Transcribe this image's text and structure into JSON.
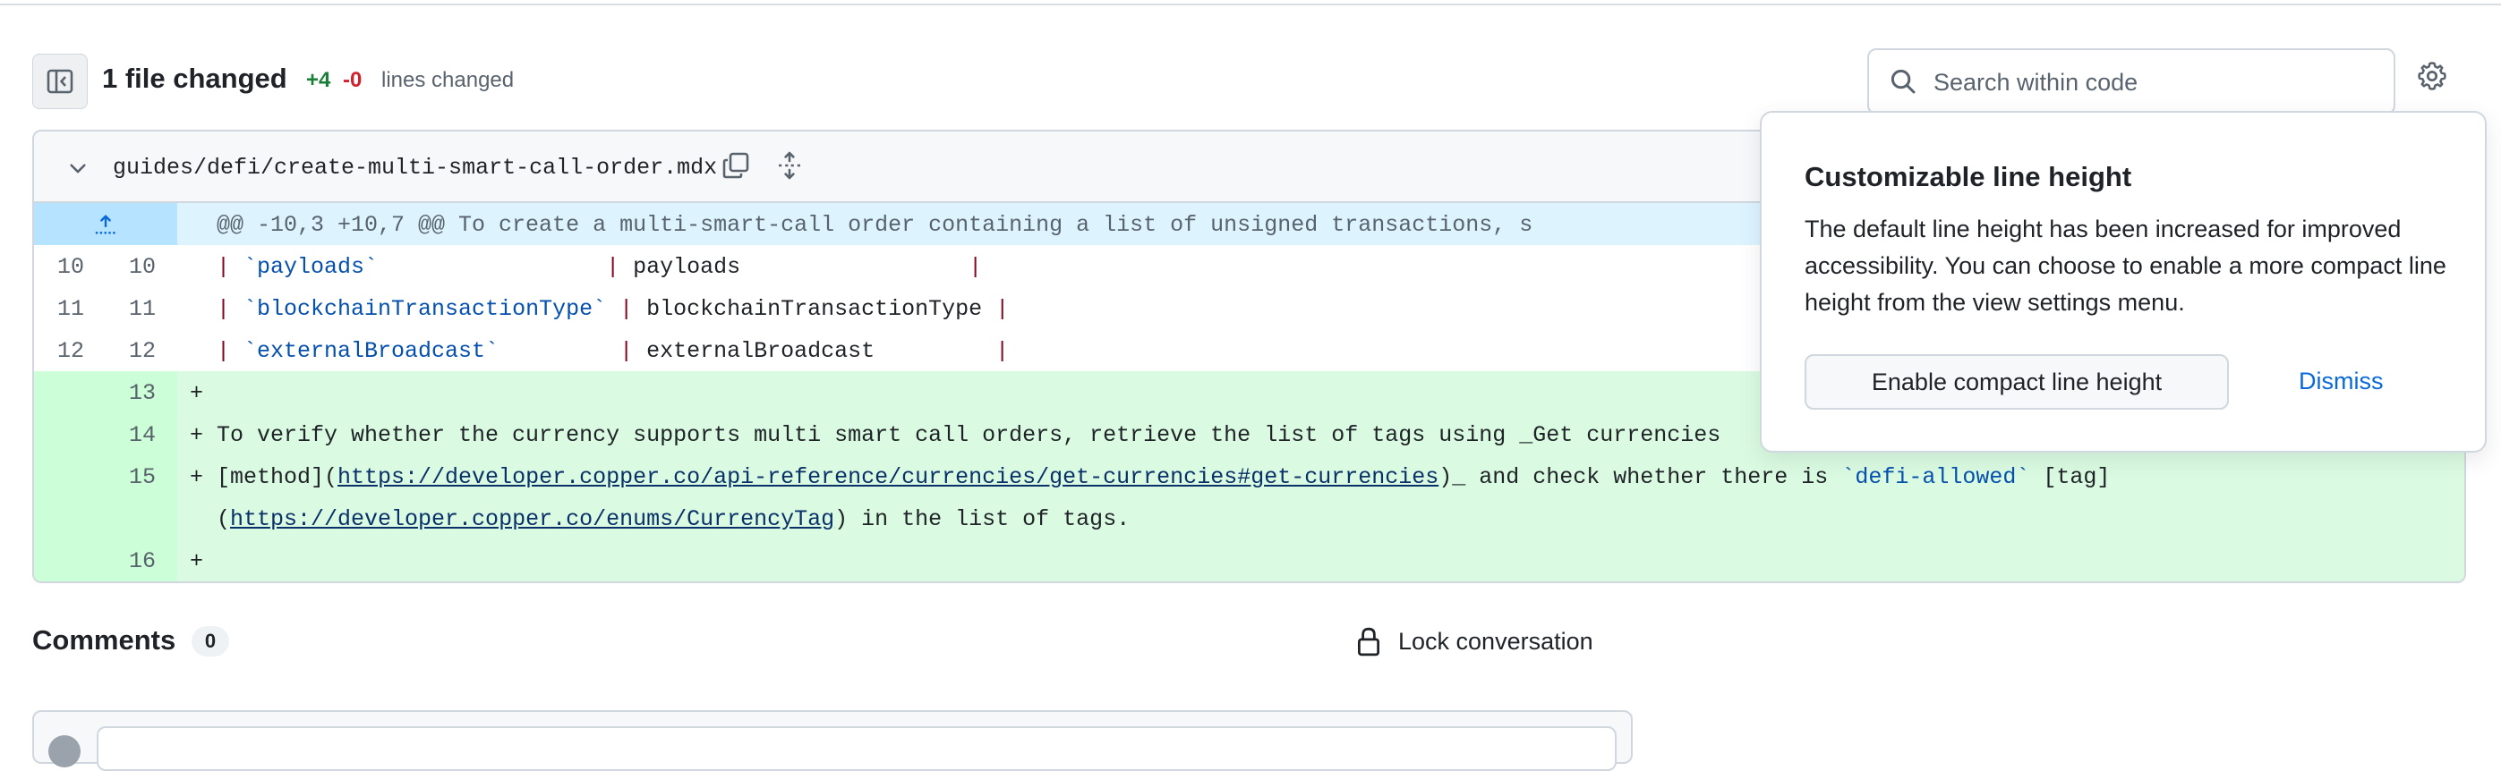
{
  "header": {
    "title": "1 file changed",
    "additions": "+4",
    "deletions": "-0",
    "lines_changed_label": "lines changed",
    "search_placeholder": "Search within code"
  },
  "file": {
    "path": "guides/defi/create-multi-smart-call-order.mdx"
  },
  "diff": {
    "hunk": "@@ -10,3 +10,7 @@ To create a multi-smart-call order containing a list of unsigned transactions, s",
    "context_rows": [
      {
        "old": "10",
        "new": "10",
        "pipe": "| ",
        "field": "`payloads`",
        "pad": "                 ",
        "sep": "| ",
        "value": "payloads",
        "tail": "                 |"
      },
      {
        "old": "11",
        "new": "11",
        "pipe": "| ",
        "field": "`blockchainTransactionType`",
        "pad": " ",
        "sep": "| ",
        "value": "blockchainTransactionType",
        "tail": " |"
      },
      {
        "old": "12",
        "new": "12",
        "pipe": "| ",
        "field": "`externalBroadcast`",
        "pad": "         ",
        "sep": "| ",
        "value": "externalBroadcast",
        "tail": "         |"
      }
    ],
    "added_rows": [
      {
        "new": "13",
        "sign": "+",
        "text": ""
      },
      {
        "new": "14",
        "sign": "+",
        "text": "To verify whether the currency supports multi smart call orders, retrieve the list of tags using _Get currencies"
      },
      {
        "new": "15",
        "sign": "+",
        "text_a": "[method](",
        "link_a": "https://developer.copper.co/api-reference/currencies/get-currencies#get-currencies",
        "text_b": ")_ and check whether there is ",
        "code_b": "`defi-allowed`",
        "text_c": " [tag]",
        "line2_a": "(",
        "link_b": "https://developer.copper.co/enums/CurrencyTag",
        "line2_b": ") in the list of tags."
      },
      {
        "new": "16",
        "sign": "+",
        "text": ""
      }
    ]
  },
  "popover": {
    "title": "Customizable line height",
    "body": "The default line height has been increased for improved accessibility. You can choose to enable a more compact line height from the view settings menu.",
    "primary_button": "Enable compact line height",
    "dismiss": "Dismiss"
  },
  "comments": {
    "title": "Comments",
    "count": "0",
    "lock_label": "Lock conversation"
  },
  "icons": {
    "sidebar_toggle": "sidebar-collapse-icon",
    "search": "search-icon",
    "settings": "gear-icon",
    "collapse": "chevron-down-icon",
    "copy": "copy-icon",
    "expand": "unfold-icon",
    "hunk_expand": "expand-up-icon",
    "lock": "lock-icon"
  },
  "colors": {
    "addition_green": "#1a7f37",
    "deletion_red": "#cf222e",
    "added_row_bg": "#dafbe1",
    "hunk_bg": "#ddf4ff",
    "link_blue": "#0969da"
  }
}
